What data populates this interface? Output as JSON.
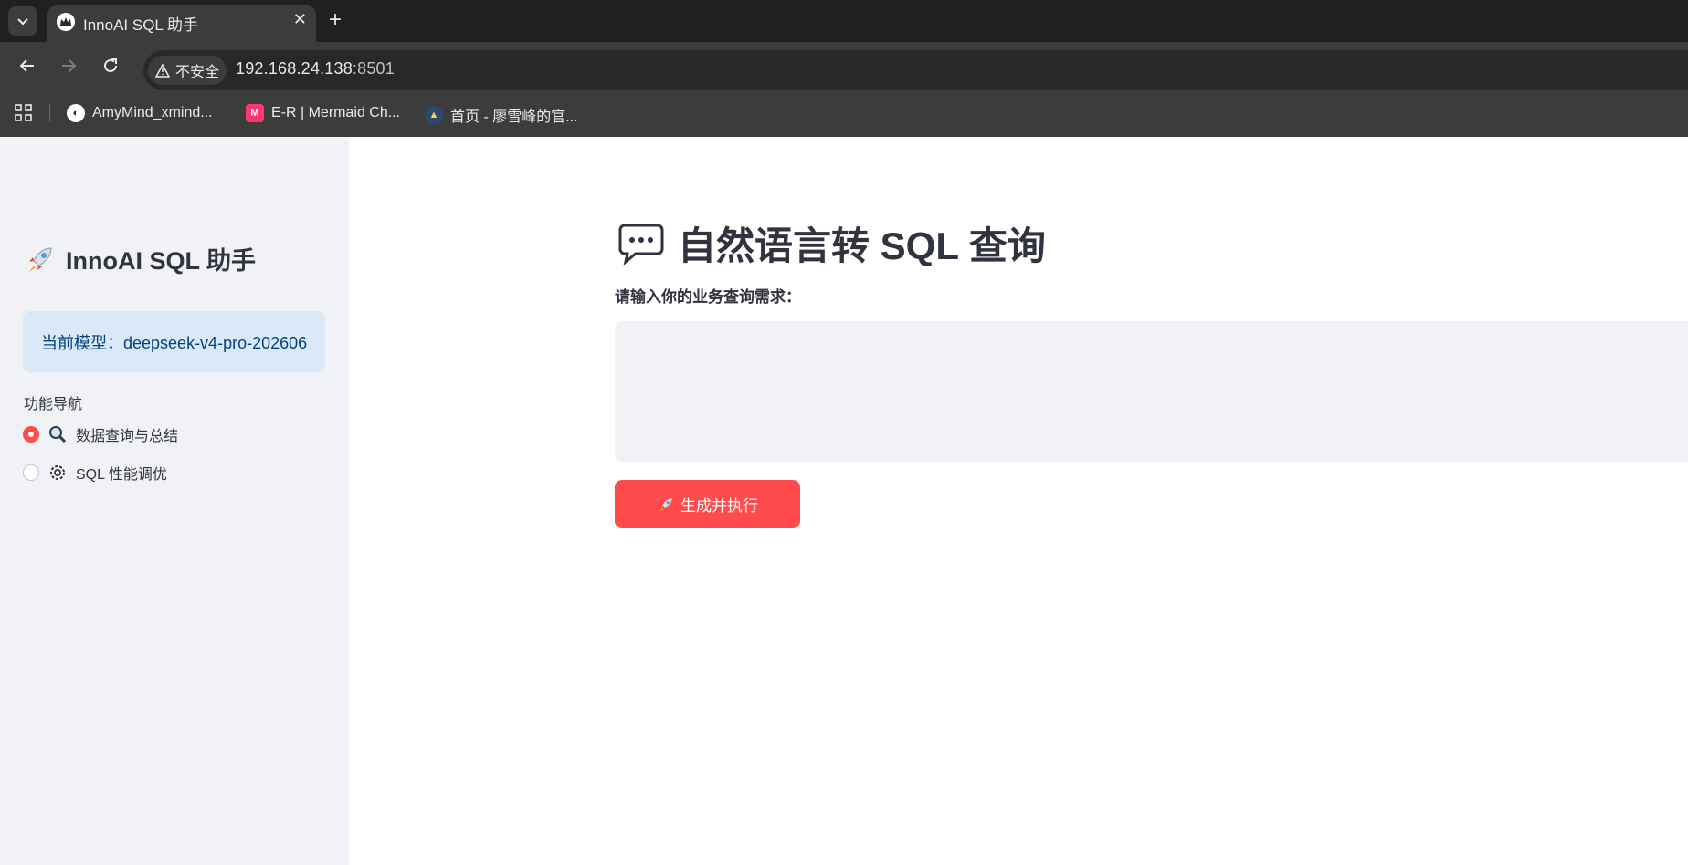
{
  "browser": {
    "tab_title": "InnoAI SQL 助手",
    "close_glyph": "✕",
    "new_tab_glyph": "+",
    "security_label": "不安全",
    "url_host": "192.168.24.138",
    "url_port": ":8501",
    "bookmarks": [
      {
        "label": "AmyMind_xmind...",
        "icon": "amymind-icon",
        "color": "#ffffff"
      },
      {
        "label": "E-R | Mermaid Ch...",
        "icon": "mermaid-icon",
        "color": "#ff3670"
      },
      {
        "label": "首页 - 廖雪峰的官...",
        "icon": "liaoxuefeng-icon",
        "color": "#2d4a6e"
      }
    ]
  },
  "sidebar": {
    "title": "InnoAI SQL 助手",
    "model_label": "当前模型：deepseek-v4-pro-202606",
    "nav_label": "功能导航",
    "nav_items": [
      {
        "label": "数据查询与总结",
        "icon": "magnifier-icon",
        "selected": true
      },
      {
        "label": "SQL 性能调优",
        "icon": "gear-icon",
        "selected": false
      }
    ]
  },
  "main": {
    "title": "自然语言转 SQL 查询",
    "input_label": "请输入你的业务查询需求：",
    "input_value": "",
    "run_button": "生成并执行"
  },
  "colors": {
    "accent": "#ff4b4b",
    "sidebar_bg": "#f0f2f6",
    "info_bg": "#dbe8f8",
    "info_text": "#004280"
  }
}
